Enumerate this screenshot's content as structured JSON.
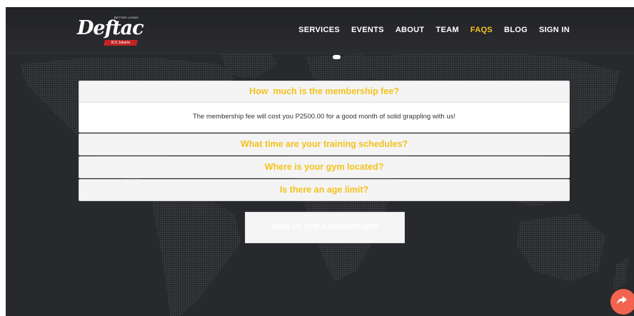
{
  "brand": {
    "tagline": "BETTER LIVING",
    "name": "Deftac",
    "ribbon": "BJJ Jakarta"
  },
  "nav": [
    {
      "label": "SERVICES",
      "active": false
    },
    {
      "label": "EVENTS",
      "active": false
    },
    {
      "label": "ABOUT",
      "active": false
    },
    {
      "label": "TEAM",
      "active": false
    },
    {
      "label": "FAQS",
      "active": true
    },
    {
      "label": "BLOG",
      "active": false
    },
    {
      "label": "SIGN IN",
      "active": false
    }
  ],
  "faq": [
    {
      "question": "How  much is the membership fee?",
      "answer": "The membership fee will cost you P2500.00 for a good month of solid grappling with us!",
      "expanded": true
    },
    {
      "question": "What time are your training schedules?",
      "expanded": false
    },
    {
      "question": "Where is your gym located?",
      "expanded": false
    },
    {
      "question": "Is there an age limit?",
      "expanded": false
    }
  ],
  "cta": {
    "label": "SIGN UP FOR A MEMBERSHIP"
  },
  "colors": {
    "accent": "#f4c21c",
    "background": "#28292c",
    "fab": "#f26450"
  },
  "icons": {
    "fab": "share-icon"
  }
}
